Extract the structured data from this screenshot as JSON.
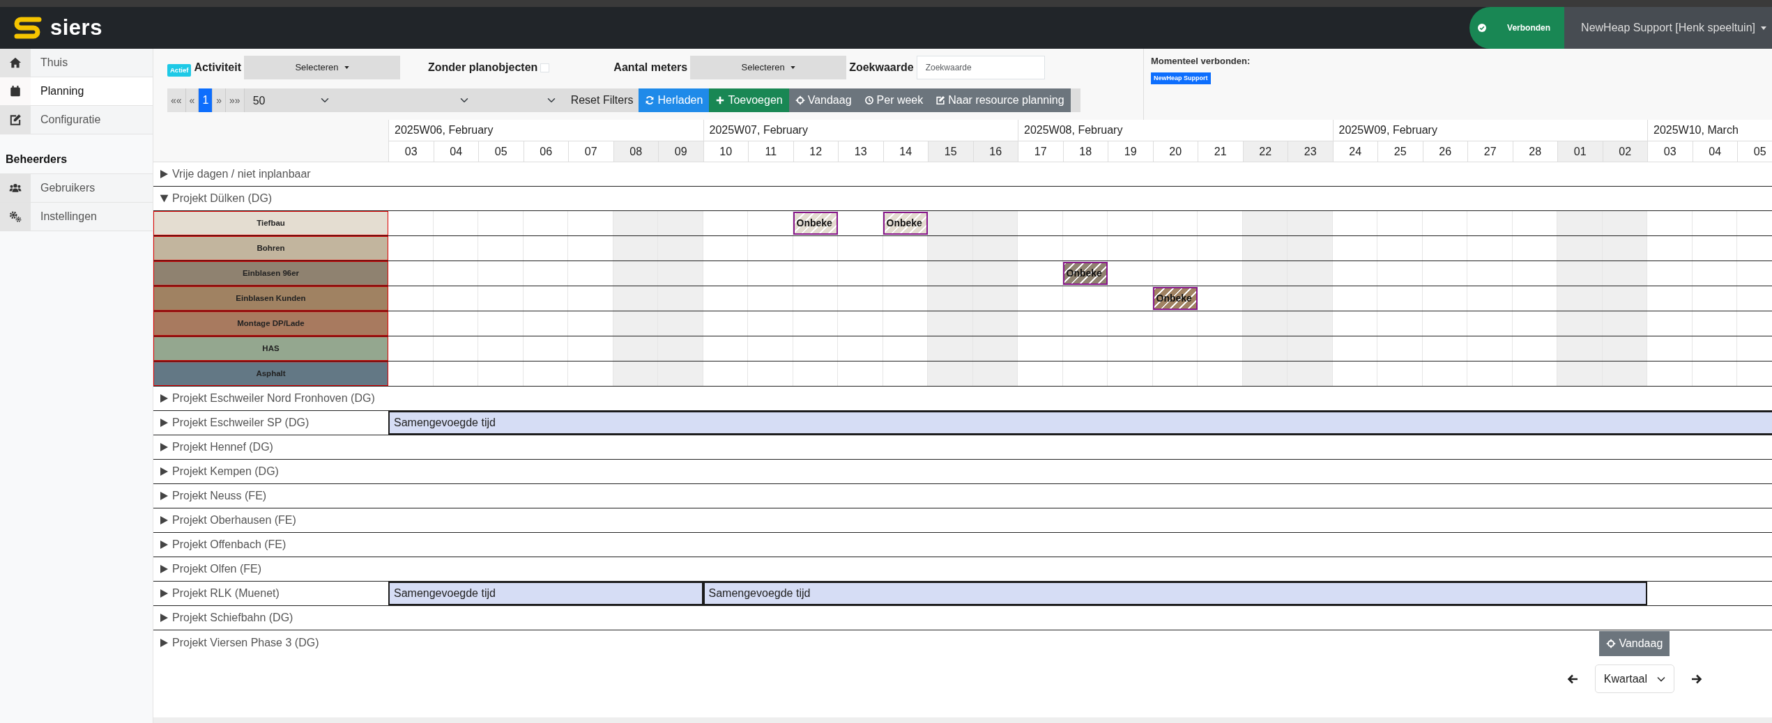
{
  "app": {
    "logo": "siers",
    "connection": {
      "label": "Verbonden",
      "connected": true
    },
    "user": "NewHeap Support [Henk speeltuin]"
  },
  "sidebar": {
    "items": [
      {
        "label": "Thuis",
        "selected": false
      },
      {
        "label": "Planning",
        "selected": true
      },
      {
        "label": "Configuratie",
        "selected": false
      }
    ],
    "section": "Beheerders",
    "admin_items": [
      {
        "label": "Gebruikers",
        "selected": false
      },
      {
        "label": "Instellingen",
        "selected": false
      }
    ]
  },
  "filters": {
    "status_badge": "Actief",
    "activity": {
      "label": "Activiteit",
      "value": "Selecteren"
    },
    "without_objects": {
      "label": "Zonder planobjecten",
      "checked": false
    },
    "meters": {
      "label": "Aantal meters",
      "value": "Selecteren"
    },
    "search": {
      "label": "Zoekwaarde",
      "placeholder": "Zoekwaarde"
    }
  },
  "toolbar": {
    "pagination": [
      {
        "label": "««",
        "selected": false
      },
      {
        "label": "«",
        "selected": false
      },
      {
        "label": "1",
        "selected": true
      },
      {
        "label": "»",
        "selected": false
      },
      {
        "label": "»»",
        "selected": false
      }
    ],
    "page_size": "50",
    "reset": "Reset Filters",
    "buttons": [
      {
        "label": "Herladen",
        "kind": "reload"
      },
      {
        "label": "Toevoegen",
        "kind": "add"
      },
      {
        "label": "Vandaag",
        "kind": "today"
      },
      {
        "label": "Per week",
        "kind": "week"
      },
      {
        "label": "Naar resource planning",
        "kind": "resource"
      }
    ]
  },
  "connected_panel": {
    "title": "Momenteel verbonden:",
    "users": [
      "NewHeap Support"
    ]
  },
  "timeline": {
    "weeks": [
      {
        "label": "2025W06, February",
        "days": [
          {
            "label": "03",
            "weekend": false
          },
          {
            "label": "04",
            "weekend": false
          },
          {
            "label": "05",
            "weekend": false
          },
          {
            "label": "06",
            "weekend": false
          },
          {
            "label": "07",
            "weekend": false
          },
          {
            "label": "08",
            "weekend": true
          },
          {
            "label": "09",
            "weekend": true
          }
        ]
      },
      {
        "label": "2025W07, February",
        "days": [
          {
            "label": "10",
            "weekend": false
          },
          {
            "label": "11",
            "weekend": false
          },
          {
            "label": "12",
            "weekend": false
          },
          {
            "label": "13",
            "weekend": false
          },
          {
            "label": "14",
            "weekend": false
          },
          {
            "label": "15",
            "weekend": true
          },
          {
            "label": "16",
            "weekend": true
          }
        ]
      },
      {
        "label": "2025W08, February",
        "days": [
          {
            "label": "17",
            "weekend": false
          },
          {
            "label": "18",
            "weekend": false
          },
          {
            "label": "19",
            "weekend": false
          },
          {
            "label": "20",
            "weekend": false
          },
          {
            "label": "21",
            "weekend": false
          },
          {
            "label": "22",
            "weekend": true
          },
          {
            "label": "23",
            "weekend": true
          }
        ]
      },
      {
        "label": "2025W09, February",
        "days": [
          {
            "label": "24",
            "weekend": false
          },
          {
            "label": "25",
            "weekend": false
          },
          {
            "label": "26",
            "weekend": false
          },
          {
            "label": "27",
            "weekend": false
          },
          {
            "label": "28",
            "weekend": false
          },
          {
            "label": "01",
            "weekend": true
          },
          {
            "label": "02",
            "weekend": true
          }
        ]
      },
      {
        "label": "2025W10, March",
        "days": [
          {
            "label": "03",
            "weekend": false
          },
          {
            "label": "04",
            "weekend": false
          },
          {
            "label": "05",
            "weekend": false
          }
        ]
      }
    ]
  },
  "groups": [
    {
      "label": "Vrije dagen / niet inplanbaar",
      "expanded": false
    },
    {
      "label": "Projekt Dülken (DG)",
      "expanded": true,
      "resources": [
        {
          "label": "Tiefbau",
          "color": "#e4ddd1",
          "cells": [
            null,
            null,
            null,
            null,
            null,
            null,
            null,
            null,
            null,
            {
              "label": "Onbeke"
            },
            null,
            {
              "label": "Onbeke"
            },
            null,
            null,
            null,
            null,
            null,
            null,
            null,
            null,
            null,
            null,
            null,
            null,
            null,
            null,
            null,
            null,
            null,
            null,
            null
          ]
        },
        {
          "label": "Bohren",
          "color": "#c2b59e"
        },
        {
          "label": "Einblasen 96er",
          "color": "#8f8270",
          "cells": [
            null,
            null,
            null,
            null,
            null,
            null,
            null,
            null,
            null,
            null,
            null,
            null,
            null,
            null,
            null,
            {
              "label": "Onbeke"
            },
            null,
            null,
            null,
            null,
            null,
            null,
            null,
            null,
            null,
            null,
            null,
            null,
            null,
            null,
            null
          ]
        },
        {
          "label": "Einblasen Kunden",
          "color": "#a08262",
          "cells": [
            null,
            null,
            null,
            null,
            null,
            null,
            null,
            null,
            null,
            null,
            null,
            null,
            null,
            null,
            null,
            null,
            null,
            {
              "label": "Onbeke"
            },
            null,
            null,
            null,
            null,
            null,
            null,
            null,
            null,
            null,
            null,
            null,
            null,
            null
          ]
        },
        {
          "label": "Montage DP/Lade",
          "color": "#a87a5f"
        },
        {
          "label": "HAS",
          "color": "#94a78f"
        },
        {
          "label": "Asphalt",
          "color": "#637885"
        }
      ]
    },
    {
      "label": "Projekt Eschweiler Nord Fronhoven (DG)",
      "expanded": false
    },
    {
      "label": "Projekt Eschweiler SP (DG)",
      "expanded": false,
      "cells": [
        {
          "kind": "bar",
          "label": "Samengevoegde tijd"
        },
        null,
        null,
        null,
        null,
        null,
        null,
        null,
        null,
        null,
        null,
        null,
        null,
        null,
        null,
        null,
        null,
        null,
        null,
        null,
        null,
        null,
        null,
        null,
        null,
        null,
        null,
        null,
        null,
        null,
        null
      ]
    },
    {
      "label": "Projekt Hennef (DG)",
      "expanded": false
    },
    {
      "label": "Projekt Kempen (DG)",
      "expanded": false
    },
    {
      "label": "Projekt Neuss (FE)",
      "expanded": false
    },
    {
      "label": "Projekt Oberhausen (FE)",
      "expanded": false
    },
    {
      "label": "Projekt Offenbach (FE)",
      "expanded": false
    },
    {
      "label": "Projekt Olfen (FE)",
      "expanded": false
    },
    {
      "label": "Projekt RLK (Muenet)",
      "expanded": false,
      "cells": [
        {
          "kind": "bar",
          "label": "Samengevoegde tijd"
        },
        null,
        null,
        null,
        null,
        null,
        null,
        {
          "kind": "bar",
          "label": "Samengevoegde tijd"
        },
        null,
        null,
        null,
        null,
        null,
        null,
        null,
        null,
        null,
        null,
        null,
        null,
        null,
        null,
        null,
        null,
        null,
        null,
        null,
        null,
        {
          "kind": "end"
        },
        null,
        null
      ]
    },
    {
      "label": "Projekt Schiefbahn (DG)",
      "expanded": false
    },
    {
      "label": "Projekt Viersen Phase 3 (DG)",
      "expanded": false
    }
  ],
  "footer": {
    "today": "Vandaag",
    "range": "Kwartaal"
  }
}
